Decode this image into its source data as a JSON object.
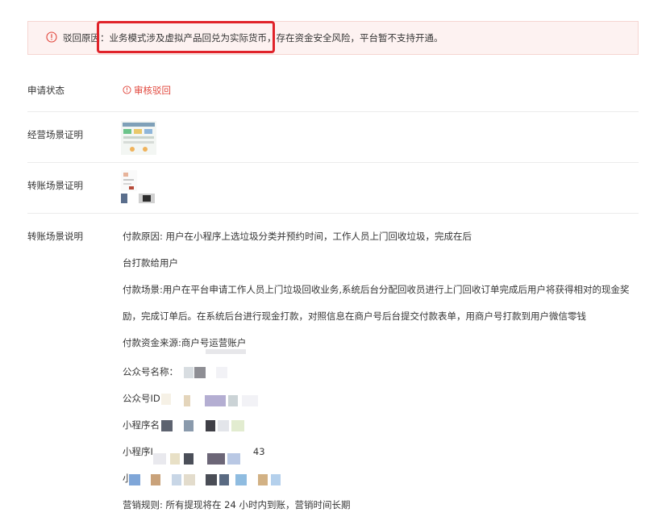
{
  "alert": {
    "icon": "alert-circle-icon",
    "prefix": "驳回原因",
    "highlighted": "：业务模式涉及虚拟产品回兑为实际货币",
    "rest": "，存在资金安全风险，平台暂不支持开通。",
    "highlight_color": "#e0232a"
  },
  "fields": {
    "status_label": "申请状态",
    "status_value": "审核驳回",
    "status_icon": "warning-circle-icon",
    "status_color": "#e1453b",
    "business_label": "经营场景证明",
    "transfer_proof_label": "转账场景证明",
    "transfer_desc_label": "转账场景说明"
  },
  "description": {
    "line1": "付款原因: 用户在小程序上选垃圾分类并预约时间，工作人员上门回收垃圾，完成在后",
    "line2": "台打款给用户",
    "line3": "付款场景:用户在平台申请工作人员上门垃圾回收业务,系统后台分配回收员进行上门回收订单完成后用户将获得相对的现金奖",
    "line4": "励，完成订单后。在系统后台进行现金打款，对照信息在商户号后台提交付款表单，用商户号打款到用户微信零钱",
    "line5": "付款资金来源:商户号运营账户",
    "line6": "公众号名称：",
    "line7": "公众号ID",
    "line8": "小程序名",
    "line9_prefix": "小程序I",
    "line9_suffix": "43",
    "line10": "小",
    "line11": "营销规则: 所有提现将在 24 小时内到账，营销时间长期"
  }
}
